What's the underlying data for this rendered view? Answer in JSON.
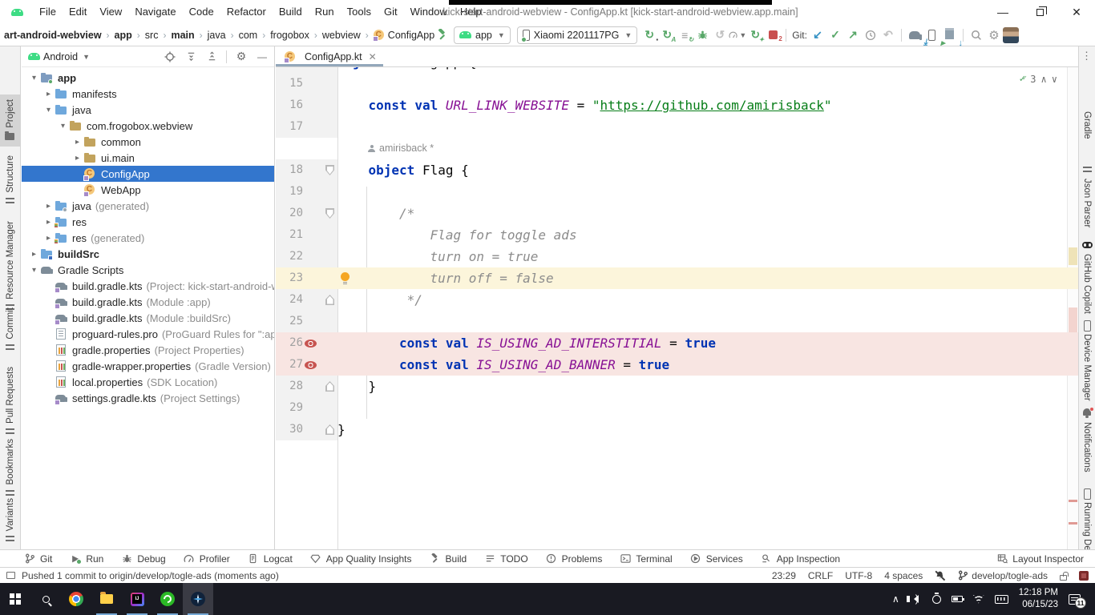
{
  "app": {
    "title": "kick-start-android-webview - ConfigApp.kt [kick-start-android-webview.app.main]"
  },
  "menu_bar": [
    "File",
    "Edit",
    "View",
    "Navigate",
    "Code",
    "Refactor",
    "Build",
    "Run",
    "Tools",
    "Git",
    "Window",
    "Help"
  ],
  "breadcrumbs": [
    {
      "label": "art-android-webview",
      "bold": true
    },
    {
      "label": "app",
      "bold": true
    },
    {
      "label": "src",
      "bold": false
    },
    {
      "label": "main",
      "bold": true
    },
    {
      "label": "java",
      "bold": false
    },
    {
      "label": "com",
      "bold": false
    },
    {
      "label": "frogobox",
      "bold": false
    },
    {
      "label": "webview",
      "bold": false
    },
    {
      "label": "ConfigApp",
      "bold": false,
      "icon": "kotlin"
    }
  ],
  "toolbar": {
    "run_config": "app",
    "device": "Xiaomi 2201117PG",
    "git_label": "Git:",
    "stop_count": "2"
  },
  "project_panel": {
    "selector_label": "Android",
    "tree": [
      {
        "label": "app",
        "depth": 0,
        "state": "expanded",
        "icon": "folder-app",
        "bold": true
      },
      {
        "label": "manifests",
        "depth": 1,
        "state": "collapsed",
        "icon": "folder"
      },
      {
        "label": "java",
        "depth": 1,
        "state": "expanded",
        "icon": "folder"
      },
      {
        "label": "com.frogobox.webview",
        "depth": 2,
        "state": "expanded",
        "icon": "package"
      },
      {
        "label": "common",
        "depth": 3,
        "state": "collapsed",
        "icon": "package"
      },
      {
        "label": "ui.main",
        "depth": 3,
        "state": "collapsed",
        "icon": "package"
      },
      {
        "label": "ConfigApp",
        "depth": 3,
        "state": "none",
        "icon": "kotlin",
        "selected": true
      },
      {
        "label": "WebApp",
        "depth": 3,
        "state": "none",
        "icon": "kotlin"
      },
      {
        "label": "java",
        "annotation": "(generated)",
        "depth": 1,
        "state": "collapsed",
        "icon": "folder-gen"
      },
      {
        "label": "res",
        "depth": 1,
        "state": "collapsed",
        "icon": "folder-res"
      },
      {
        "label": "res",
        "annotation": "(generated)",
        "depth": 1,
        "state": "collapsed",
        "icon": "folder-res"
      },
      {
        "label": "buildSrc",
        "depth": 0,
        "state": "collapsed",
        "icon": "folder-module",
        "bold": true
      },
      {
        "label": "Gradle Scripts",
        "depth": 0,
        "state": "expanded",
        "icon": "gradle"
      },
      {
        "label": "build.gradle.kts",
        "annotation": "(Project: kick-start-android-webv",
        "depth": 1,
        "state": "none",
        "icon": "gradle-file"
      },
      {
        "label": "build.gradle.kts",
        "annotation": "(Module :app)",
        "depth": 1,
        "state": "none",
        "icon": "gradle-file"
      },
      {
        "label": "build.gradle.kts",
        "annotation": "(Module :buildSrc)",
        "depth": 1,
        "state": "none",
        "icon": "gradle-file"
      },
      {
        "label": "proguard-rules.pro",
        "annotation": "(ProGuard Rules for \":app\")",
        "depth": 1,
        "state": "none",
        "icon": "text-file"
      },
      {
        "label": "gradle.properties",
        "annotation": "(Project Properties)",
        "depth": 1,
        "state": "none",
        "icon": "props"
      },
      {
        "label": "gradle-wrapper.properties",
        "annotation": "(Gradle Version)",
        "depth": 1,
        "state": "none",
        "icon": "props"
      },
      {
        "label": "local.properties",
        "annotation": "(SDK Location)",
        "depth": 1,
        "state": "none",
        "icon": "props"
      },
      {
        "label": "settings.gradle.kts",
        "annotation": "(Project Settings)",
        "depth": 1,
        "state": "none",
        "icon": "gradle-file"
      }
    ]
  },
  "left_stripe": [
    {
      "label": "Project",
      "icon": "folder",
      "active": true
    },
    {
      "label": "Structure",
      "icon": "structure"
    },
    {
      "label": "Resource Manager",
      "icon": "resource-manager"
    },
    {
      "label": "Commit",
      "icon": "commit"
    },
    {
      "label": "Pull Requests",
      "icon": "pull-requests"
    },
    {
      "label": "Bookmarks",
      "icon": "bookmarks"
    },
    {
      "label": "Variants",
      "icon": "variants"
    }
  ],
  "right_stripe": [
    {
      "label": "Gradle",
      "icon": "gradle"
    },
    {
      "label": "Json Parser",
      "icon": "json-parser"
    },
    {
      "label": "GitHub Copilot",
      "icon": "copilot"
    },
    {
      "label": "Device Manager",
      "icon": "device-manager"
    },
    {
      "label": "Notifications",
      "icon": "notifications"
    },
    {
      "label": "Running Devices",
      "icon": "running-devices"
    }
  ],
  "editor": {
    "tab_title": "ConfigApp.kt",
    "inspections_count": "3",
    "author_inlay": "amirisback *",
    "lines": [
      {
        "partial": true,
        "num": "",
        "indent": 0,
        "fold": "open",
        "tokens": [
          [
            "kw",
            "object"
          ],
          [
            "pl",
            " ConfigApp {"
          ]
        ]
      },
      {
        "num": "15",
        "indent": 0,
        "tokens": []
      },
      {
        "num": "16",
        "indent": 4,
        "tokens": [
          [
            "kw",
            "const val "
          ],
          [
            "id",
            "URL_LINK_WEBSITE"
          ],
          [
            "pl",
            " = "
          ],
          [
            "str",
            "\""
          ],
          [
            "strU",
            "https://github.com/amirisback"
          ],
          [
            "str",
            "\""
          ]
        ]
      },
      {
        "num": "17",
        "indent": 0,
        "tokens": []
      },
      {
        "inlay": true
      },
      {
        "num": "18",
        "indent": 4,
        "fold": "open",
        "tokens": [
          [
            "kw",
            "object"
          ],
          [
            "pl",
            " Flag {"
          ]
        ]
      },
      {
        "num": "19",
        "indent": 0,
        "tokens": []
      },
      {
        "num": "20",
        "indent": 8,
        "fold": "open",
        "tokens": [
          [
            "cmt",
            "/*"
          ]
        ]
      },
      {
        "num": "21",
        "indent": 12,
        "tokens": [
          [
            "cmt",
            "Flag for toggle ads"
          ]
        ]
      },
      {
        "num": "22",
        "indent": 12,
        "tokens": [
          [
            "cmt",
            "turn on = true"
          ]
        ]
      },
      {
        "num": "23",
        "indent": 12,
        "hl": "caret",
        "bulb": true,
        "tokens": [
          [
            "cmt",
            "turn off = false"
          ]
        ]
      },
      {
        "num": "24",
        "indent": 9,
        "fold": "close",
        "tokens": [
          [
            "cmt",
            "*/"
          ]
        ]
      },
      {
        "num": "25",
        "indent": 0,
        "tokens": []
      },
      {
        "num": "26",
        "indent": 8,
        "hl": "pink",
        "eye": true,
        "tokens": [
          [
            "kw",
            "const val "
          ],
          [
            "id",
            "IS_USING_AD_INTERSTITIAL"
          ],
          [
            "pl",
            " = "
          ],
          [
            "kw",
            "true"
          ]
        ]
      },
      {
        "num": "27",
        "indent": 8,
        "hl": "pink",
        "eye": true,
        "tokens": [
          [
            "kw",
            "const val "
          ],
          [
            "id",
            "IS_USING_AD_BANNER"
          ],
          [
            "pl",
            " = "
          ],
          [
            "kw",
            "true"
          ]
        ]
      },
      {
        "num": "28",
        "indent": 4,
        "fold": "close",
        "tokens": [
          [
            "pl",
            "}"
          ]
        ]
      },
      {
        "num": "29",
        "indent": 0,
        "tokens": []
      },
      {
        "num": "30",
        "indent": 0,
        "fold": "close",
        "tokens": [
          [
            "pl",
            "}"
          ]
        ]
      }
    ]
  },
  "bottom_toolbar": {
    "left": [
      {
        "label": "Git",
        "icon": "branch"
      },
      {
        "label": "Run",
        "icon": "run"
      },
      {
        "label": "Debug",
        "icon": "bug"
      },
      {
        "label": "Profiler",
        "icon": "gauge"
      },
      {
        "label": "Logcat",
        "icon": "logcat"
      },
      {
        "label": "App Quality Insights",
        "icon": "gem"
      },
      {
        "label": "Build",
        "icon": "hammer"
      },
      {
        "label": "TODO",
        "icon": "todo-list"
      },
      {
        "label": "Problems",
        "icon": "problems"
      },
      {
        "label": "Terminal",
        "icon": "terminal"
      },
      {
        "label": "Services",
        "icon": "services"
      },
      {
        "label": "App Inspection",
        "icon": "app-inspection"
      }
    ],
    "right": [
      {
        "label": "Layout Inspector",
        "icon": "layout-inspector"
      }
    ]
  },
  "status_bar": {
    "message": "Pushed 1 commit to origin/develop/togle-ads (moments ago)",
    "caret": "23:29",
    "line_ending": "CRLF",
    "encoding": "UTF-8",
    "indent": "4 spaces",
    "branch": "develop/togle-ads"
  },
  "taskbar": {
    "time": "12:18 PM",
    "date": "06/15/23",
    "notification_count": "11"
  },
  "colors": {
    "selection_blue": "#3376cd",
    "caret_line": "#fcf5db",
    "changed_line": "#f8e5e2",
    "keyword": "#0033b3",
    "identifier": "#871094",
    "string": "#067d17",
    "comment": "#8c8c8c",
    "accent_green": "#59a869",
    "accent_blue": "#3592c4",
    "accent_red": "#c94f4f"
  }
}
